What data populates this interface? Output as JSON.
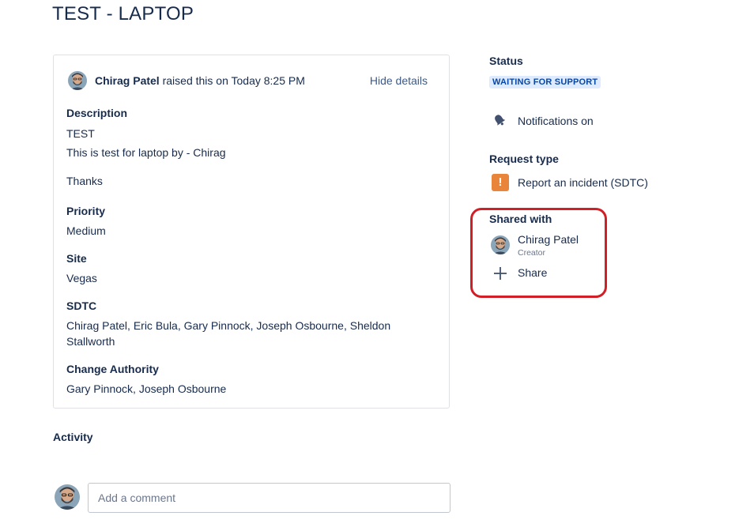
{
  "title": "TEST - LAPTOP",
  "request": {
    "author": "Chirag Patel",
    "raised_text": " raised this on Today 8:25 PM",
    "hide_details": "Hide details"
  },
  "fields": {
    "description_label": "Description",
    "description_line1": "TEST",
    "description_line2": "This is test for laptop by - Chirag",
    "description_line3": "Thanks",
    "priority_label": "Priority",
    "priority_value": "Medium",
    "site_label": "Site",
    "site_value": "Vegas",
    "sdtc_label": "SDTC",
    "sdtc_value_line1": "Chirag Patel, Eric Bula, Gary Pinnock, Joseph Osbourne, Sheldon",
    "sdtc_value_line2": "Stallworth",
    "change_authority_label": "Change Authority",
    "change_authority_value": "Gary Pinnock, Joseph Osbourne"
  },
  "activity": {
    "title": "Activity",
    "comment_placeholder": "Add a comment"
  },
  "sidebar": {
    "status_label": "Status",
    "status_value": "WAITING FOR SUPPORT",
    "notifications": "Notifications on",
    "request_type_label": "Request type",
    "request_type_value": "Report an incident (SDTC)",
    "shared_with_label": "Shared with",
    "shared_user": "Chirag Patel",
    "shared_user_role": "Creator",
    "share_button": "Share"
  },
  "colors": {
    "status_bg": "#deebff",
    "status_text": "#0747a6",
    "incident_icon": "#e9853a",
    "highlight": "#d11f26",
    "link": "#3c5a8a"
  }
}
